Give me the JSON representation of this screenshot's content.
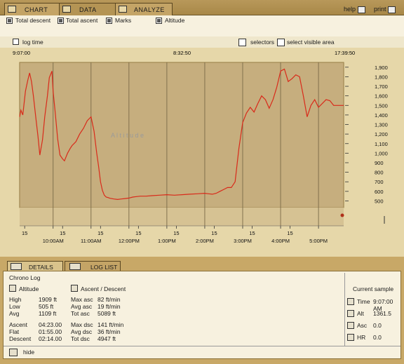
{
  "tabs": [
    {
      "label": "CHART",
      "icon": "chart-icon"
    },
    {
      "label": "DATA",
      "icon": "data-icon"
    },
    {
      "label": "ANALYZE",
      "icon": "analyze-icon"
    }
  ],
  "top_right": {
    "help": "help",
    "print": "print"
  },
  "series_toggles": [
    {
      "label": "Total descent",
      "checked": true
    },
    {
      "label": "Total ascent",
      "checked": true
    },
    {
      "label": "Marks",
      "checked": true
    },
    {
      "label": "Altitude",
      "checked": true
    }
  ],
  "options": {
    "log_time": "log time",
    "selectors": "selectors",
    "select_visible_area": "select visible area"
  },
  "time_range": {
    "start": "9:07:00",
    "middle": "8:32:50",
    "end": "17:39:50"
  },
  "chart_data": {
    "type": "line",
    "watermark": "A l t i t u d e",
    "y_ticks": [
      "1,900",
      "1,800",
      "1,700",
      "1,600",
      "1,500",
      "1,400",
      "1,300",
      "1,200",
      "1,100",
      "1,000",
      "900",
      "800",
      "700",
      "600",
      "500"
    ],
    "ylim": [
      430,
      1950
    ],
    "x_ticks": [
      {
        "label": "15",
        "t": 9.25
      },
      {
        "label": "10:00AM",
        "t": 10.0
      },
      {
        "label": "15",
        "t": 10.25
      },
      {
        "label": "11:00AM",
        "t": 11.0
      },
      {
        "label": "15",
        "t": 11.25
      },
      {
        "label": "12:00PM",
        "t": 12.0
      },
      {
        "label": "15",
        "t": 12.25
      },
      {
        "label": "1:00PM",
        "t": 13.0
      },
      {
        "label": "15",
        "t": 13.25
      },
      {
        "label": "2:00PM",
        "t": 14.0
      },
      {
        "label": "15",
        "t": 14.25
      },
      {
        "label": "3:00PM",
        "t": 15.0
      },
      {
        "label": "15",
        "t": 15.25
      },
      {
        "label": "4:00PM",
        "t": 16.0
      },
      {
        "label": "15",
        "t": 16.25
      },
      {
        "label": "5:00PM",
        "t": 17.0
      }
    ],
    "xlim": [
      9.117,
      17.664
    ],
    "series": [
      {
        "color": "#d92a1a",
        "x": [
          9.117,
          9.15,
          9.2,
          9.27,
          9.33,
          9.38,
          9.43,
          9.48,
          9.55,
          9.6,
          9.65,
          9.72,
          9.78,
          9.85,
          9.9,
          9.97,
          10.0,
          10.05,
          10.12,
          10.18,
          10.25,
          10.3,
          10.38,
          10.45,
          10.5,
          10.6,
          10.7,
          10.8,
          10.9,
          11.0,
          11.08,
          11.15,
          11.2,
          11.25,
          11.3,
          11.35,
          11.4,
          11.45,
          11.5,
          11.6,
          11.7,
          11.8,
          11.9,
          12.0,
          12.1,
          12.2,
          12.3,
          12.45,
          12.6,
          12.8,
          13.0,
          13.2,
          13.4,
          13.6,
          13.8,
          14.0,
          14.1,
          14.2,
          14.3,
          14.4,
          14.5,
          14.6,
          14.7,
          14.8,
          14.9,
          15.0,
          15.1,
          15.2,
          15.3,
          15.4,
          15.5,
          15.6,
          15.7,
          15.8,
          15.9,
          16.0,
          16.1,
          16.2,
          16.3,
          16.4,
          16.5,
          16.6,
          16.7,
          16.8,
          16.9,
          17.0,
          17.1,
          17.2,
          17.3,
          17.4,
          17.5,
          17.6,
          17.664
        ],
        "y": [
          1380,
          1450,
          1400,
          1650,
          1760,
          1840,
          1750,
          1600,
          1350,
          1180,
          980,
          1140,
          1380,
          1600,
          1790,
          1860,
          1650,
          1450,
          1150,
          980,
          940,
          920,
          1000,
          1050,
          1080,
          1120,
          1200,
          1260,
          1340,
          1380,
          1230,
          1000,
          860,
          700,
          610,
          560,
          540,
          535,
          528,
          520,
          515,
          520,
          525,
          530,
          540,
          545,
          550,
          550,
          555,
          560,
          565,
          560,
          565,
          570,
          575,
          580,
          575,
          570,
          580,
          600,
          620,
          640,
          640,
          700,
          1050,
          1320,
          1420,
          1480,
          1430,
          1520,
          1600,
          1560,
          1470,
          1560,
          1690,
          1860,
          1880,
          1750,
          1780,
          1820,
          1800,
          1600,
          1380,
          1500,
          1560,
          1480,
          1520,
          1560,
          1550,
          1500,
          1500,
          1500,
          1500
        ]
      }
    ]
  },
  "details_tabs": {
    "details": "DETAILS",
    "log_list": "LOG LIST"
  },
  "chrono_log": "Chrono Log",
  "section_altitude": "Altitude",
  "section_ascdesc": "Ascent / Descent",
  "altitude_stats": [
    {
      "k": "High",
      "v": "1909 ft"
    },
    {
      "k": "Low",
      "v": "505 ft"
    },
    {
      "k": "Avg",
      "v": "1109 ft"
    }
  ],
  "time_stats": [
    {
      "k": "Ascent",
      "v": "04:23.00"
    },
    {
      "k": "Flat",
      "v": "01:55.00"
    },
    {
      "k": "Descent",
      "v": "02:14.00"
    }
  ],
  "asc_stats": [
    {
      "k": "Max asc",
      "v": "82 ft/min"
    },
    {
      "k": "Avg asc",
      "v": "19 ft/min"
    },
    {
      "k": "Tot asc",
      "v": "5089 ft"
    }
  ],
  "dsc_stats": [
    {
      "k": "Max dsc",
      "v": "141 ft/min"
    },
    {
      "k": "Avg dsc",
      "v": "36 ft/min"
    },
    {
      "k": "Tot dsc",
      "v": "4947 ft"
    }
  ],
  "current_sample": {
    "title": "Current sample",
    "rows": [
      {
        "k": "Time",
        "v": "9:07:00 AM",
        "icon": "time-icon"
      },
      {
        "k": "Alt",
        "v": "1361.5",
        "icon": "altitude-icon"
      },
      {
        "k": "Asc",
        "v": "0.0",
        "icon": "ascent-icon"
      },
      {
        "k": "HR",
        "v": "0.0",
        "icon": "heart-rate-icon"
      }
    ]
  },
  "hide_label": "hide"
}
